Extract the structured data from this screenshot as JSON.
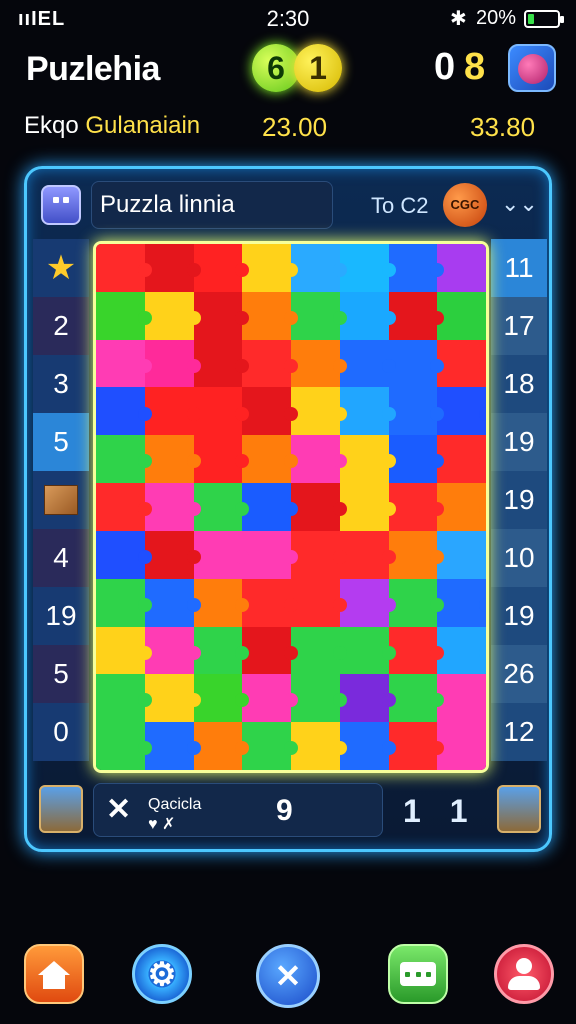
{
  "status": {
    "carrier": "ııIEL",
    "time": "2:30",
    "bluetooth_icon": "✱",
    "battery_text": "20%",
    "battery_level": 0.2
  },
  "header": {
    "title": "Puzlehia",
    "coin_a": "6",
    "coin_b": "1",
    "score_a": "0",
    "score_b": "8"
  },
  "stats": {
    "left_label_a": "Ekqo ",
    "left_label_b": "Gulanaiain",
    "mid_value": "23.00",
    "right_value": "33.80"
  },
  "panel": {
    "puzzle_name": "Puzzla linnia",
    "level_text": "To C2",
    "badge_text": "CGC",
    "chevron": "⌄⌄"
  },
  "left_column": [
    "★",
    "2",
    "3",
    "5",
    "□",
    "4",
    "19",
    "5",
    "0"
  ],
  "right_column": [
    "11",
    "17",
    "18",
    "19",
    "19",
    "10",
    "19",
    "26",
    "12"
  ],
  "grid_colors": [
    "#ff2a2a",
    "#e4161c",
    "#ff2222",
    "#ffd21a",
    "#2aaaff",
    "#19b8ff",
    "#1f6bff",
    "#a83cf0",
    "#39d42b",
    "#ffd21a",
    "#e4161c",
    "#ff7d0c",
    "#2fd34a",
    "#1aa8ff",
    "#e4161c",
    "#2ccf3e",
    "#ff3cb4",
    "#ff2a9a",
    "#e4161c",
    "#ff2a2a",
    "#ff7d0c",
    "#1f6bff",
    "#1f6bff",
    "#ff2a2a",
    "#1f4fff",
    "#ff2222",
    "#ff2222",
    "#e4161c",
    "#ffd21a",
    "#21a6ff",
    "#1f6bff",
    "#1f4fff",
    "#2fd34a",
    "#ff7d0c",
    "#ff2222",
    "#ff7d0c",
    "#ff3cb4",
    "#ffd21a",
    "#1a5cff",
    "#ff2a2a",
    "#ff2a2a",
    "#ff3cb4",
    "#2fd34a",
    "#1a5cff",
    "#e4161c",
    "#ffd21a",
    "#ff2a2a",
    "#ff7d0c",
    "#1f4fff",
    "#e4161c",
    "#ff3cb4",
    "#ff3cb4",
    "#ff2a2a",
    "#ff2a2a",
    "#ff7d0c",
    "#2aa6ff",
    "#2fd34a",
    "#1f6bff",
    "#ff7d0c",
    "#ff2a2a",
    "#ff2a2a",
    "#b43cf0",
    "#2fd34a",
    "#1f6bff",
    "#ffd21a",
    "#ff3cb4",
    "#2fd34a",
    "#e4161c",
    "#2fd34a",
    "#2fd34a",
    "#ff2a2a",
    "#21a6ff",
    "#2fd34a",
    "#ffd21a",
    "#39d42b",
    "#ff3cb4",
    "#2fd34a",
    "#7a2adc",
    "#2fd34a",
    "#ff3cb4",
    "#2fd34a",
    "#1f6bff",
    "#ff7d0c",
    "#2fd34a",
    "#ffd21a",
    "#1f6bff",
    "#ff2a2a",
    "#ff3cb4"
  ],
  "footer": {
    "close_icon": "✕",
    "label": "Qacicla\n♥ ✗",
    "count": "9",
    "ratio": "1 1"
  },
  "nav": {
    "settings_icon": "⚙",
    "play_icon": "✕"
  }
}
